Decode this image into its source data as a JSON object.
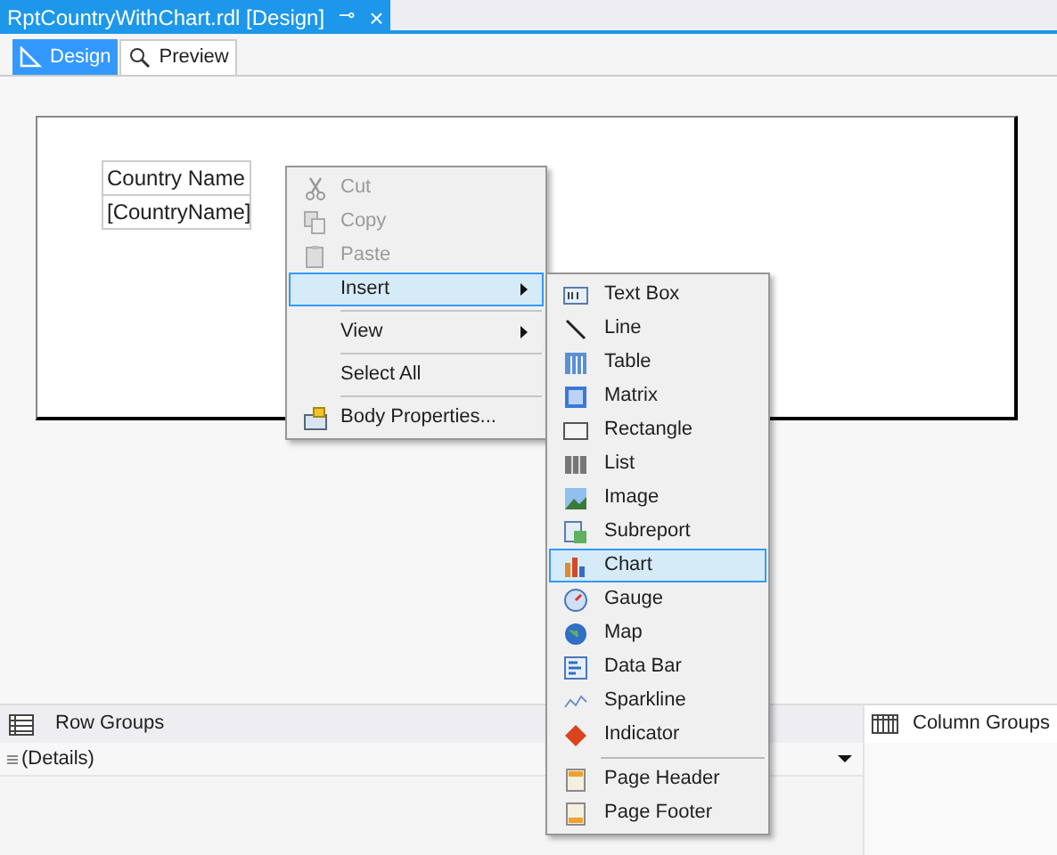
{
  "document_tab": {
    "title": "RptCountryWithChart.rdl [Design]",
    "pin": "⊸",
    "close": "×"
  },
  "view_tabs": [
    {
      "label": "Design",
      "selected": true
    },
    {
      "label": "Preview",
      "selected": false
    }
  ],
  "report_body": {
    "textboxes": [
      {
        "text": "Country Name"
      },
      {
        "text": "[CountryName]"
      }
    ]
  },
  "context_menu": {
    "items": [
      {
        "kind": "item",
        "label": "Cut",
        "disabled": true,
        "selected": false,
        "submenu": false
      },
      {
        "kind": "item",
        "label": "Copy",
        "disabled": true,
        "selected": false,
        "submenu": false
      },
      {
        "kind": "item",
        "label": "Paste",
        "disabled": true,
        "selected": false,
        "submenu": false
      },
      {
        "kind": "item",
        "label": "Insert",
        "disabled": false,
        "selected": true,
        "submenu": true
      },
      {
        "kind": "separator"
      },
      {
        "kind": "item",
        "label": "View",
        "disabled": false,
        "selected": false,
        "submenu": true
      },
      {
        "kind": "separator"
      },
      {
        "kind": "item",
        "label": "Select All",
        "disabled": false,
        "selected": false,
        "submenu": false
      },
      {
        "kind": "separator"
      },
      {
        "kind": "item",
        "label": "Body Properties...",
        "disabled": false,
        "selected": false,
        "submenu": false
      }
    ]
  },
  "insert_submenu": {
    "items": [
      {
        "kind": "item",
        "label": "Text Box",
        "selected": false
      },
      {
        "kind": "item",
        "label": "Line",
        "selected": false
      },
      {
        "kind": "item",
        "label": "Table",
        "selected": false
      },
      {
        "kind": "item",
        "label": "Matrix",
        "selected": false
      },
      {
        "kind": "item",
        "label": "Rectangle",
        "selected": false
      },
      {
        "kind": "item",
        "label": "List",
        "selected": false
      },
      {
        "kind": "item",
        "label": "Image",
        "selected": false
      },
      {
        "kind": "item",
        "label": "Subreport",
        "selected": false
      },
      {
        "kind": "item",
        "label": "Chart",
        "selected": true
      },
      {
        "kind": "item",
        "label": "Gauge",
        "selected": false
      },
      {
        "kind": "item",
        "label": "Map",
        "selected": false
      },
      {
        "kind": "item",
        "label": "Data Bar",
        "selected": false
      },
      {
        "kind": "item",
        "label": "Sparkline",
        "selected": false
      },
      {
        "kind": "item",
        "label": "Indicator",
        "selected": false
      },
      {
        "kind": "separator"
      },
      {
        "kind": "item",
        "label": "Page Header",
        "selected": false
      },
      {
        "kind": "item",
        "label": "Page Footer",
        "selected": false
      }
    ]
  },
  "row_groups": {
    "title": "Row Groups",
    "rows": [
      {
        "label": "(Details)"
      }
    ]
  },
  "column_groups": {
    "title": "Column Groups"
  }
}
